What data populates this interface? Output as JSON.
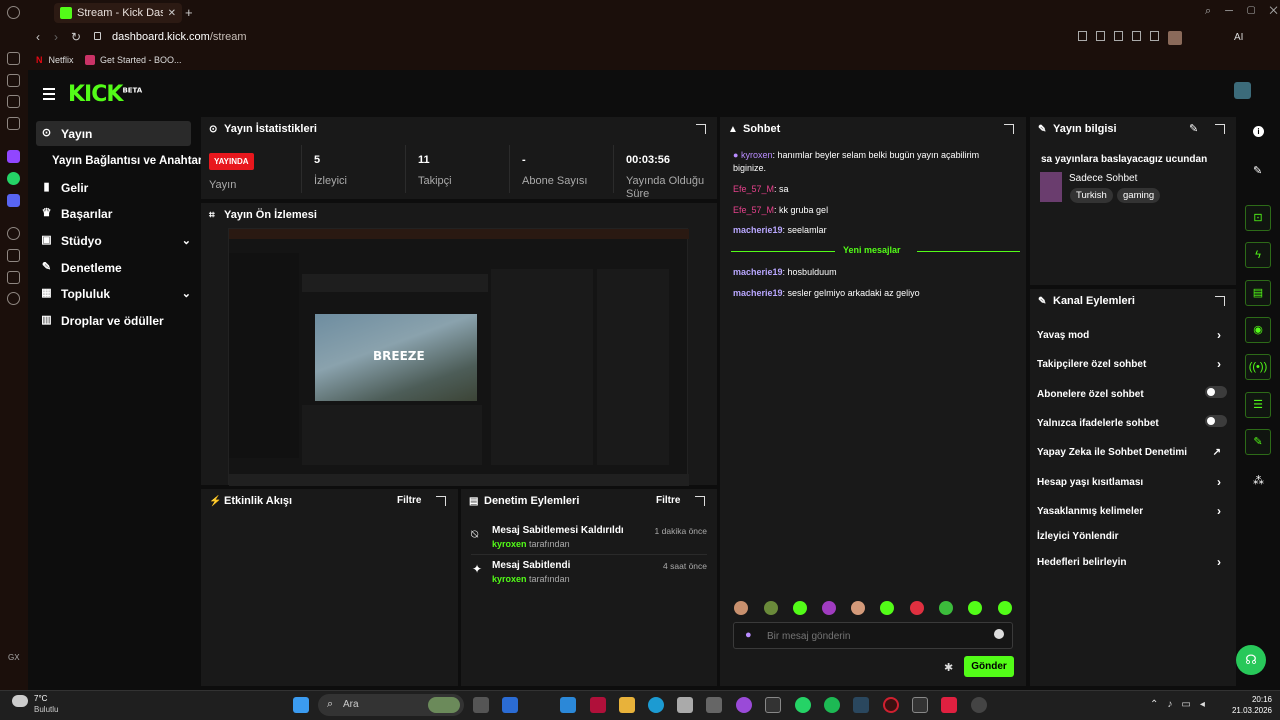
{
  "browser": {
    "tab_title": "Stream - Kick Dashbo",
    "url_domain": "dashboard.kick.com",
    "url_path": "/stream",
    "bookmarks": [
      "Netflix",
      "Get Started - BOO..."
    ],
    "ai_label": "AI"
  },
  "app": {
    "logo": "KICK",
    "logo_tag": "BETA"
  },
  "sidebar": {
    "items": [
      {
        "label": "Yayın"
      },
      {
        "label": "Yayın Bağlantısı ve Anahtarı"
      },
      {
        "label": "Gelir"
      },
      {
        "label": "Başarılar"
      },
      {
        "label": "Stüdyo"
      },
      {
        "label": "Denetleme"
      },
      {
        "label": "Topluluk"
      },
      {
        "label": "Droplar ve ödüller"
      }
    ]
  },
  "stats": {
    "title": "Yayın İstatistikleri",
    "badge": "YAYINDA",
    "badge_label": "Yayın",
    "items": [
      {
        "value": "5",
        "label": "İzleyici"
      },
      {
        "value": "11",
        "label": "Takipçi"
      },
      {
        "value": "-",
        "label": "Abone Sayısı"
      },
      {
        "value": "00:03:56",
        "label": "Yayında Olduğu Süre"
      }
    ]
  },
  "preview": {
    "title": "Yayın Ön İzlemesi",
    "game_text": "BREEZE"
  },
  "activity": {
    "title": "Etkinlik Akışı",
    "filter": "Filtre"
  },
  "moderation": {
    "title": "Denetim Eylemleri",
    "filter": "Filtre",
    "items": [
      {
        "action": "Mesaj Sabitlemesi Kaldırıldı",
        "user": "kyroxen",
        "suffix": "tarafından",
        "time": "1 dakika önce"
      },
      {
        "action": "Mesaj Sabitlendi",
        "user": "kyroxen",
        "suffix": "tarafından",
        "time": "4 saat önce"
      }
    ]
  },
  "chat": {
    "title": "Sohbet",
    "messages": [
      {
        "user": "kyroxen",
        "text": ": hanımlar beyler selam belki bugün yayın açabilirim biginize."
      },
      {
        "user": "Efe_57_M",
        "text": ": sa"
      },
      {
        "user": "Efe_57_M",
        "text": ": kk gruba gel"
      },
      {
        "user": "macherie19",
        "text": ": seelamlar"
      },
      {
        "user": "macherie19",
        "text": ": hosbulduum"
      },
      {
        "user": "macherie19",
        "text": ": sesler gelmiyo arkadaki az geliyo"
      }
    ],
    "new_messages": "Yeni mesajlar",
    "input_placeholder": "Bir mesaj gönderin",
    "send": "Gönder"
  },
  "stream_info": {
    "title": "Yayın bilgisi",
    "stream_title": "sa yayınlara baslayacagız ucundan",
    "category": "Sadece Sohbet",
    "tags": [
      "Turkish",
      "gaming"
    ]
  },
  "channel_actions": {
    "title": "Kanal Eylemleri",
    "items": [
      {
        "label": "Yavaş mod",
        "control": "arrow"
      },
      {
        "label": "Takipçilere özel sohbet",
        "control": "arrow"
      },
      {
        "label": "Abonelere özel sohbet",
        "control": "toggle"
      },
      {
        "label": "Yalnızca ifadelerle sohbet",
        "control": "toggle"
      },
      {
        "label": "Yapay Zeka ile Sohbet Denetimi",
        "control": "external"
      },
      {
        "label": "Hesap yaşı kısıtlaması",
        "control": "arrow"
      },
      {
        "label": "Yasaklanmış kelimeler",
        "control": "arrow"
      },
      {
        "label": "İzleyici Yönlendir",
        "control": "none"
      },
      {
        "label": "Hedefleri belirleyin",
        "control": "arrow"
      }
    ]
  },
  "taskbar": {
    "weather_temp": "7°C",
    "weather_desc": "Bulutlu",
    "search": "Ara",
    "time": "20:16",
    "date": "21.03.2026"
  },
  "colors": {
    "accent": "#53fc18",
    "live": "#e8171d",
    "panel": "#191919"
  }
}
